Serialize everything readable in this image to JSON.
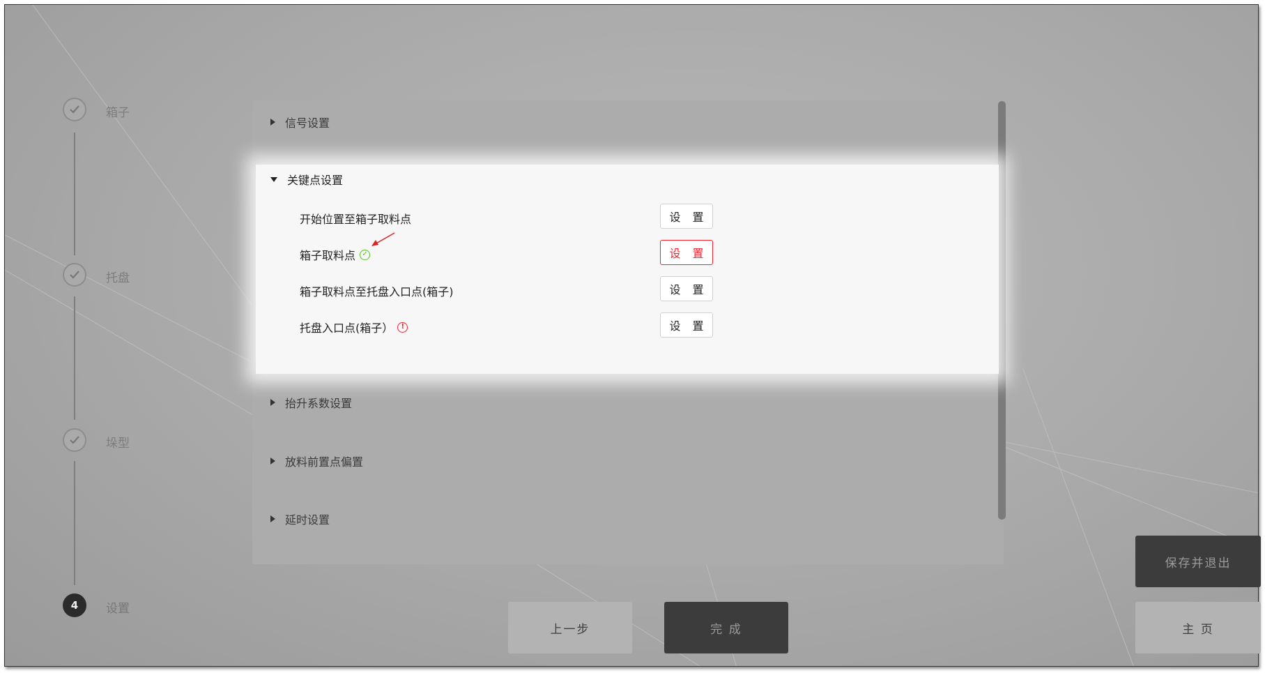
{
  "steps": [
    {
      "label": "箱子",
      "state": "done",
      "icon": "check-icon"
    },
    {
      "label": "托盘",
      "state": "done",
      "icon": "check-icon"
    },
    {
      "label": "垛型",
      "state": "done",
      "icon": "check-icon"
    },
    {
      "label": "设置",
      "state": "active",
      "number": "4"
    }
  ],
  "sections": {
    "signal": "信号设置",
    "keypoints": "关键点设置",
    "lift": "抬升系数设置",
    "placement_offset": "放料前置点偏置",
    "delay": "延时设置"
  },
  "keypoint_rows": [
    {
      "label": "开始位置至箱子取料点",
      "button": "设 置",
      "status": "none"
    },
    {
      "label": "箱子取料点",
      "button": "设 置",
      "status": "ok",
      "status_icon": "check-circle-icon"
    },
    {
      "label": "箱子取料点至托盘入口点(箱子)",
      "button": "设 置",
      "status": "none"
    },
    {
      "label": "托盘入口点(箱子）",
      "button": "设 置",
      "status": "warning",
      "status_icon": "exclamation-circle-icon"
    }
  ],
  "status_glyphs": {
    "ok": "✓",
    "warn": "!"
  },
  "buttons": {
    "prev": "上一步",
    "done": "完 成",
    "save_exit": "保存并退出",
    "home": "主 页"
  },
  "colors": {
    "success": "#52c41a",
    "danger": "#f5222d",
    "dark_button": "#3c3c3c"
  }
}
